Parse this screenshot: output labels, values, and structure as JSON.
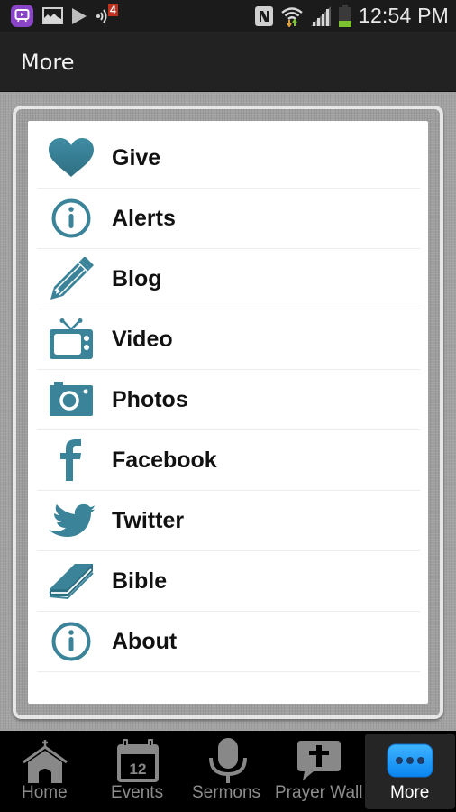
{
  "status_bar": {
    "left_icons": [
      "app-notification-icon",
      "gallery-icon",
      "play-store-icon",
      "nfc-signal-icon"
    ],
    "notification_count": "4",
    "right_icons": [
      "nfc-icon",
      "wifi-icon",
      "cell-signal-icon",
      "battery-icon"
    ],
    "time": "12:54 PM"
  },
  "action_bar": {
    "title": "More"
  },
  "accent_color": "#3a8399",
  "menu": {
    "items": [
      {
        "label": "Give",
        "icon": "heart-icon"
      },
      {
        "label": "Alerts",
        "icon": "info-icon"
      },
      {
        "label": "Blog",
        "icon": "pencil-icon"
      },
      {
        "label": "Video",
        "icon": "tv-icon"
      },
      {
        "label": "Photos",
        "icon": "camera-icon"
      },
      {
        "label": "Facebook",
        "icon": "facebook-icon"
      },
      {
        "label": "Twitter",
        "icon": "twitter-icon"
      },
      {
        "label": "Bible",
        "icon": "book-icon"
      },
      {
        "label": "About",
        "icon": "info-icon"
      }
    ]
  },
  "tabbar": {
    "tabs": [
      {
        "label": "Home",
        "icon": "church-icon",
        "active": false
      },
      {
        "label": "Events",
        "icon": "calendar-icon",
        "active": false,
        "calendar_day": "12"
      },
      {
        "label": "Sermons",
        "icon": "microphone-icon",
        "active": false
      },
      {
        "label": "Prayer Wall",
        "icon": "prayer-bubble-icon",
        "active": false
      },
      {
        "label": "More",
        "icon": "more-dots-icon",
        "active": true
      }
    ]
  }
}
